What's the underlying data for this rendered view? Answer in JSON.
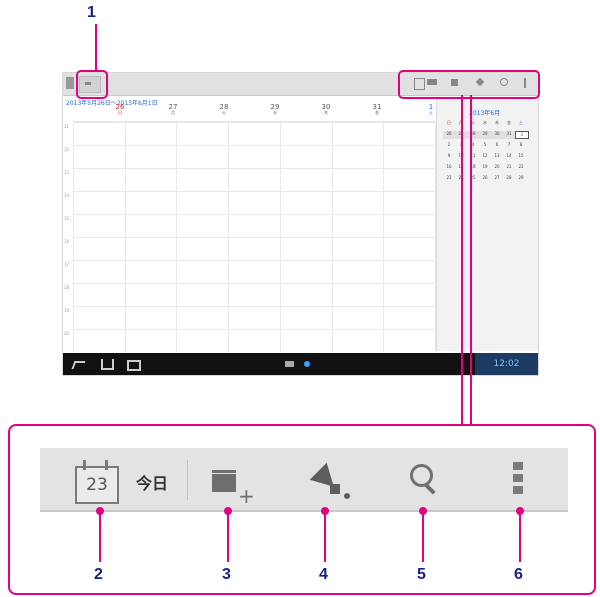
{
  "callouts": [
    "1",
    "2",
    "3",
    "4",
    "5",
    "6"
  ],
  "tablet": {
    "date_range": "2013年5月26日～2013年6月1日",
    "days": [
      {
        "d": "26",
        "w": "日"
      },
      {
        "d": "27",
        "w": "月"
      },
      {
        "d": "28",
        "w": "火"
      },
      {
        "d": "29",
        "w": "水"
      },
      {
        "d": "30",
        "w": "木"
      },
      {
        "d": "31",
        "w": "金"
      },
      {
        "d": "1",
        "w": "土"
      }
    ],
    "hours": [
      "11",
      "12",
      "13",
      "14",
      "15",
      "16",
      "17",
      "18",
      "19",
      "20"
    ],
    "minical": {
      "title": "2013年6月",
      "weekdays": [
        "日",
        "月",
        "火",
        "水",
        "木",
        "金",
        "土"
      ],
      "weeks": [
        [
          "26",
          "27",
          "28",
          "29",
          "30",
          "31",
          "1"
        ],
        [
          "2",
          "3",
          "4",
          "5",
          "6",
          "7",
          "8"
        ],
        [
          "9",
          "10",
          "11",
          "12",
          "13",
          "14",
          "15"
        ],
        [
          "16",
          "17",
          "18",
          "19",
          "20",
          "21",
          "22"
        ],
        [
          "23",
          "24",
          "25",
          "26",
          "27",
          "28",
          "29"
        ]
      ]
    },
    "clock": "12:02"
  },
  "zoom": {
    "today_date": "23",
    "today_label": "今日"
  },
  "colors": {
    "accent": "#e4007f",
    "callout": "#1b1f8a"
  }
}
